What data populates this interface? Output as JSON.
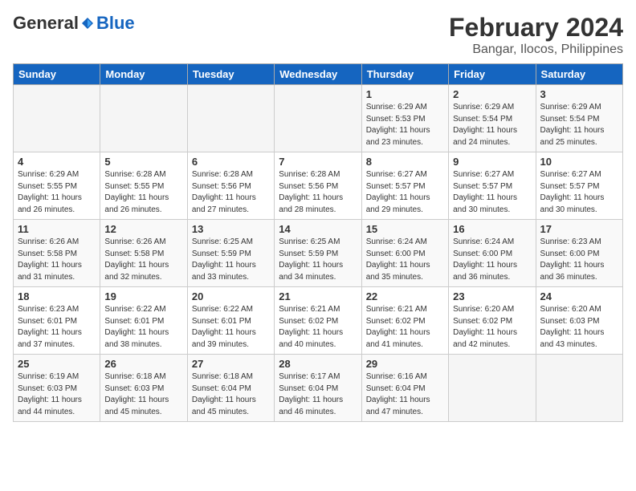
{
  "header": {
    "logo_general": "General",
    "logo_blue": "Blue",
    "month_title": "February 2024",
    "location": "Bangar, Ilocos, Philippines"
  },
  "weekdays": [
    "Sunday",
    "Monday",
    "Tuesday",
    "Wednesday",
    "Thursday",
    "Friday",
    "Saturday"
  ],
  "weeks": [
    [
      {
        "day": "",
        "info": ""
      },
      {
        "day": "",
        "info": ""
      },
      {
        "day": "",
        "info": ""
      },
      {
        "day": "",
        "info": ""
      },
      {
        "day": "1",
        "info": "Sunrise: 6:29 AM\nSunset: 5:53 PM\nDaylight: 11 hours\nand 23 minutes."
      },
      {
        "day": "2",
        "info": "Sunrise: 6:29 AM\nSunset: 5:54 PM\nDaylight: 11 hours\nand 24 minutes."
      },
      {
        "day": "3",
        "info": "Sunrise: 6:29 AM\nSunset: 5:54 PM\nDaylight: 11 hours\nand 25 minutes."
      }
    ],
    [
      {
        "day": "4",
        "info": "Sunrise: 6:29 AM\nSunset: 5:55 PM\nDaylight: 11 hours\nand 26 minutes."
      },
      {
        "day": "5",
        "info": "Sunrise: 6:28 AM\nSunset: 5:55 PM\nDaylight: 11 hours\nand 26 minutes."
      },
      {
        "day": "6",
        "info": "Sunrise: 6:28 AM\nSunset: 5:56 PM\nDaylight: 11 hours\nand 27 minutes."
      },
      {
        "day": "7",
        "info": "Sunrise: 6:28 AM\nSunset: 5:56 PM\nDaylight: 11 hours\nand 28 minutes."
      },
      {
        "day": "8",
        "info": "Sunrise: 6:27 AM\nSunset: 5:57 PM\nDaylight: 11 hours\nand 29 minutes."
      },
      {
        "day": "9",
        "info": "Sunrise: 6:27 AM\nSunset: 5:57 PM\nDaylight: 11 hours\nand 30 minutes."
      },
      {
        "day": "10",
        "info": "Sunrise: 6:27 AM\nSunset: 5:57 PM\nDaylight: 11 hours\nand 30 minutes."
      }
    ],
    [
      {
        "day": "11",
        "info": "Sunrise: 6:26 AM\nSunset: 5:58 PM\nDaylight: 11 hours\nand 31 minutes."
      },
      {
        "day": "12",
        "info": "Sunrise: 6:26 AM\nSunset: 5:58 PM\nDaylight: 11 hours\nand 32 minutes."
      },
      {
        "day": "13",
        "info": "Sunrise: 6:25 AM\nSunset: 5:59 PM\nDaylight: 11 hours\nand 33 minutes."
      },
      {
        "day": "14",
        "info": "Sunrise: 6:25 AM\nSunset: 5:59 PM\nDaylight: 11 hours\nand 34 minutes."
      },
      {
        "day": "15",
        "info": "Sunrise: 6:24 AM\nSunset: 6:00 PM\nDaylight: 11 hours\nand 35 minutes."
      },
      {
        "day": "16",
        "info": "Sunrise: 6:24 AM\nSunset: 6:00 PM\nDaylight: 11 hours\nand 36 minutes."
      },
      {
        "day": "17",
        "info": "Sunrise: 6:23 AM\nSunset: 6:00 PM\nDaylight: 11 hours\nand 36 minutes."
      }
    ],
    [
      {
        "day": "18",
        "info": "Sunrise: 6:23 AM\nSunset: 6:01 PM\nDaylight: 11 hours\nand 37 minutes."
      },
      {
        "day": "19",
        "info": "Sunrise: 6:22 AM\nSunset: 6:01 PM\nDaylight: 11 hours\nand 38 minutes."
      },
      {
        "day": "20",
        "info": "Sunrise: 6:22 AM\nSunset: 6:01 PM\nDaylight: 11 hours\nand 39 minutes."
      },
      {
        "day": "21",
        "info": "Sunrise: 6:21 AM\nSunset: 6:02 PM\nDaylight: 11 hours\nand 40 minutes."
      },
      {
        "day": "22",
        "info": "Sunrise: 6:21 AM\nSunset: 6:02 PM\nDaylight: 11 hours\nand 41 minutes."
      },
      {
        "day": "23",
        "info": "Sunrise: 6:20 AM\nSunset: 6:02 PM\nDaylight: 11 hours\nand 42 minutes."
      },
      {
        "day": "24",
        "info": "Sunrise: 6:20 AM\nSunset: 6:03 PM\nDaylight: 11 hours\nand 43 minutes."
      }
    ],
    [
      {
        "day": "25",
        "info": "Sunrise: 6:19 AM\nSunset: 6:03 PM\nDaylight: 11 hours\nand 44 minutes."
      },
      {
        "day": "26",
        "info": "Sunrise: 6:18 AM\nSunset: 6:03 PM\nDaylight: 11 hours\nand 45 minutes."
      },
      {
        "day": "27",
        "info": "Sunrise: 6:18 AM\nSunset: 6:04 PM\nDaylight: 11 hours\nand 45 minutes."
      },
      {
        "day": "28",
        "info": "Sunrise: 6:17 AM\nSunset: 6:04 PM\nDaylight: 11 hours\nand 46 minutes."
      },
      {
        "day": "29",
        "info": "Sunrise: 6:16 AM\nSunset: 6:04 PM\nDaylight: 11 hours\nand 47 minutes."
      },
      {
        "day": "",
        "info": ""
      },
      {
        "day": "",
        "info": ""
      }
    ]
  ]
}
